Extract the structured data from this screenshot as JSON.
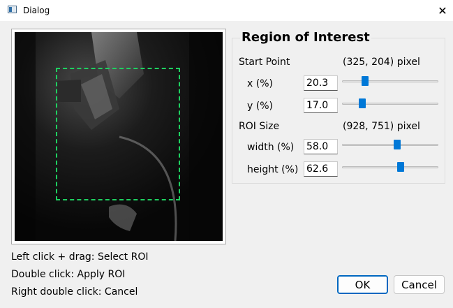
{
  "window": {
    "title": "Dialog",
    "close_icon": "close-icon"
  },
  "hints": [
    "Left click + drag: Select ROI",
    "Double click: Apply ROI",
    "Right double click: Cancel"
  ],
  "roi": {
    "title": "Region of Interest",
    "start_point": {
      "label": "Start Point",
      "value": "(325, 204) pixel",
      "x": {
        "label": "x (%)",
        "value": "20.3",
        "slider": 0.203
      },
      "y": {
        "label": "y (%)",
        "value": "17.0",
        "slider": 0.17
      }
    },
    "size": {
      "label": "ROI Size",
      "value": "(928, 751) pixel",
      "width": {
        "label": "width (%)",
        "value": "58.0",
        "slider": 0.58
      },
      "height": {
        "label": "height (%)",
        "value": "62.6",
        "slider": 0.626
      }
    }
  },
  "buttons": {
    "ok": "OK",
    "cancel": "Cancel"
  },
  "colors": {
    "accent": "#0078d7",
    "roi_outline": "#1ed060"
  }
}
